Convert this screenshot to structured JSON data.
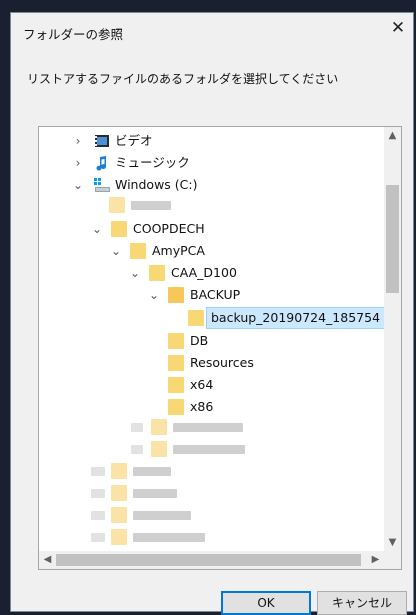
{
  "dialog": {
    "title": "フォルダーの参照",
    "close_glyph": "✕",
    "instruction": "リストアするファイルのあるフォルダを選択してください"
  },
  "tree": {
    "items": [
      {
        "label": "ビデオ",
        "twisty": "›",
        "icon": "video-folder-icon"
      },
      {
        "label": "ミュージック",
        "twisty": "›",
        "icon": "music-folder-icon"
      },
      {
        "label": "Windows (C:)",
        "twisty": "⌄",
        "icon": "drive-icon"
      },
      {
        "label": "COOPDECH",
        "twisty": "⌄",
        "icon": "folder-icon"
      },
      {
        "label": "AmyPCA",
        "twisty": "⌄",
        "icon": "folder-icon"
      },
      {
        "label": "CAA_D100",
        "twisty": "⌄",
        "icon": "folder-icon"
      },
      {
        "label": "BACKUP",
        "twisty": "⌄",
        "icon": "folder-open-icon"
      },
      {
        "label": "backup_20190724_185754",
        "twisty": "",
        "icon": "folder-icon",
        "selected": true
      },
      {
        "label": "DB",
        "twisty": "",
        "icon": "folder-icon"
      },
      {
        "label": "Resources",
        "twisty": "",
        "icon": "folder-icon"
      },
      {
        "label": "x64",
        "twisty": "",
        "icon": "folder-icon"
      },
      {
        "label": "x86",
        "twisty": "",
        "icon": "folder-icon"
      }
    ]
  },
  "scrollbars": {
    "up": "▲",
    "down": "▼",
    "left": "◀",
    "right": "▶"
  },
  "buttons": {
    "ok": "OK",
    "cancel": "キャンセル"
  },
  "colors": {
    "selection": "#cce8ff",
    "folder": "#f8d775",
    "accent": "#0078d7"
  }
}
